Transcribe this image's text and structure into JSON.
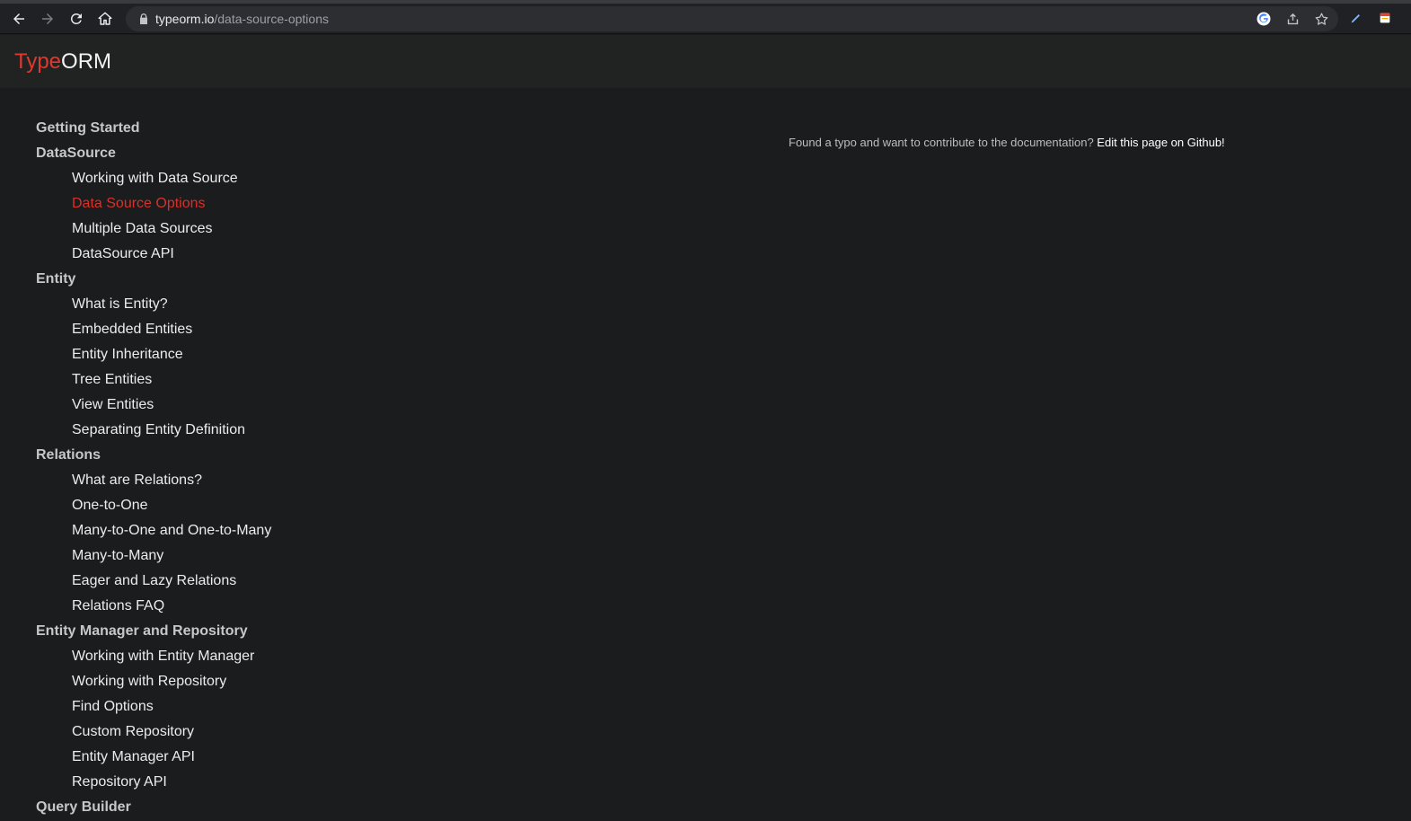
{
  "browser": {
    "url_host": "typeorm.io",
    "url_path": "/data-source-options",
    "icons": {
      "back": "back-arrow-icon",
      "forward": "forward-arrow-icon",
      "reload": "reload-icon",
      "home": "home-icon",
      "lock": "lock-icon",
      "google": "google-icon",
      "share": "share-icon",
      "star": "star-icon",
      "pen": "pen-extension-icon",
      "extension": "calendar-extension-icon"
    }
  },
  "site": {
    "logo_type": "Type",
    "logo_orm": "ORM",
    "accent_color": "#e0382e"
  },
  "sidebar": {
    "sections": [
      {
        "title": "Getting Started",
        "items": []
      },
      {
        "title": "DataSource",
        "items": [
          "Working with Data Source",
          "Data Source Options",
          "Multiple Data Sources",
          "DataSource API"
        ]
      },
      {
        "title": "Entity",
        "items": [
          "What is Entity?",
          "Embedded Entities",
          "Entity Inheritance",
          "Tree Entities",
          "View Entities",
          "Separating Entity Definition"
        ]
      },
      {
        "title": "Relations",
        "items": [
          "What are Relations?",
          "One-to-One",
          "Many-to-One and One-to-Many",
          "Many-to-Many",
          "Eager and Lazy Relations",
          "Relations FAQ"
        ]
      },
      {
        "title": "Entity Manager and Repository",
        "items": [
          "Working with Entity Manager",
          "Working with Repository",
          "Find Options",
          "Custom Repository",
          "Entity Manager API",
          "Repository API"
        ]
      },
      {
        "title": "Query Builder",
        "items": []
      }
    ],
    "active_item": "Data Source Options"
  },
  "content": {
    "typo_text": "Found a typo and want to contribute to the documentation? ",
    "edit_link": "Edit this page on Github!"
  }
}
